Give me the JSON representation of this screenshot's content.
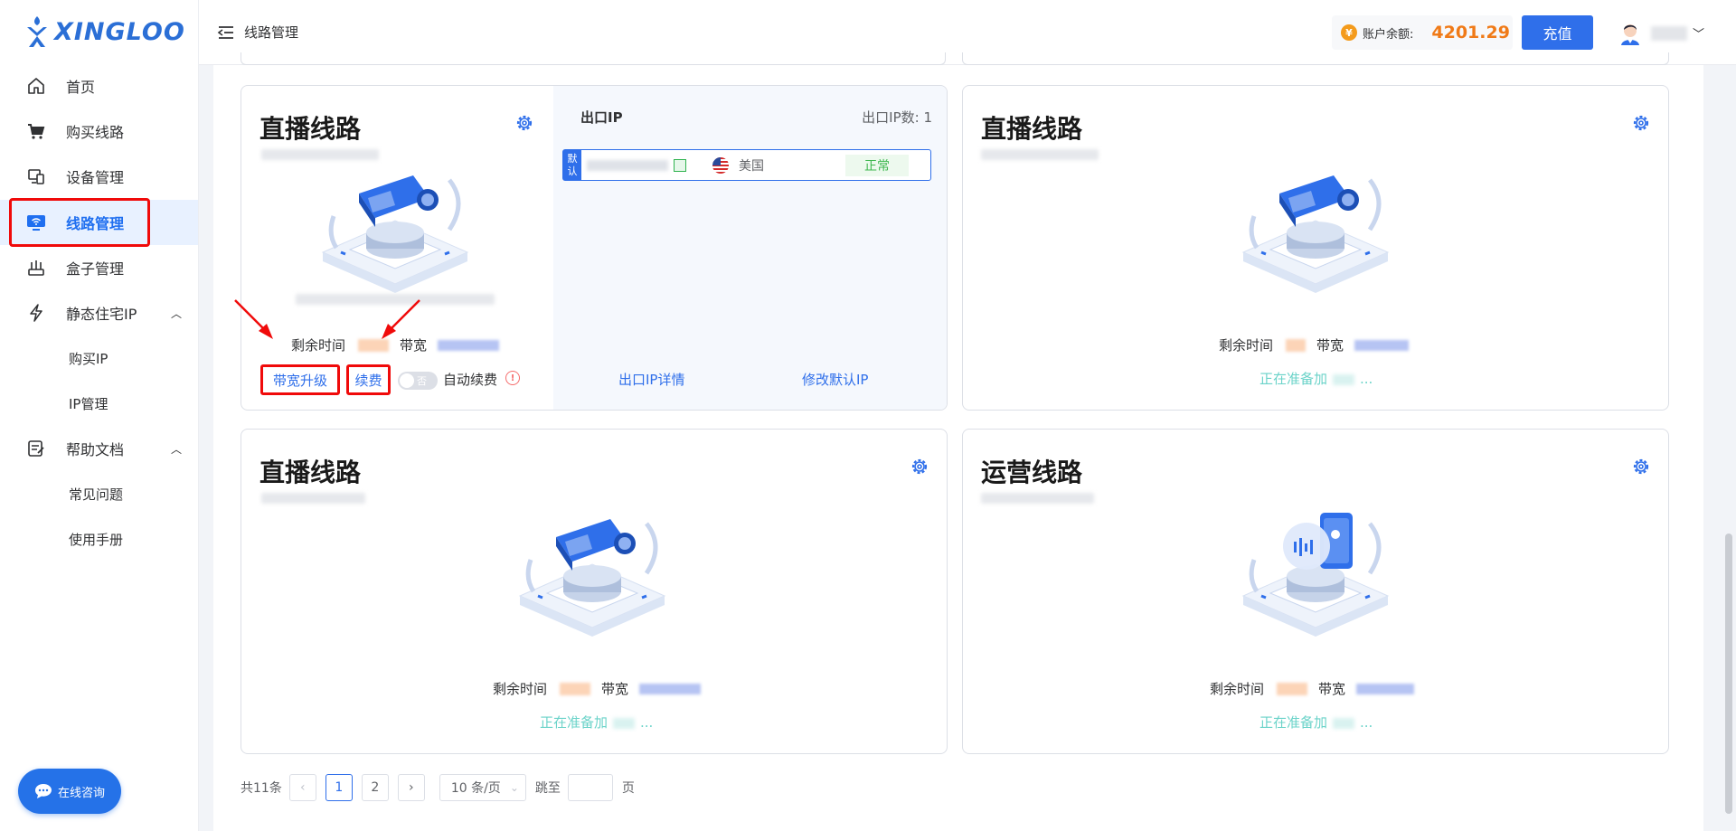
{
  "app": {
    "brand": "XINGLOO"
  },
  "sidebar": {
    "items": [
      {
        "label": "首页",
        "icon": "home-icon"
      },
      {
        "label": "购买线路",
        "icon": "cart-icon"
      },
      {
        "label": "设备管理",
        "icon": "device-icon"
      },
      {
        "label": "线路管理",
        "icon": "monitor-wifi-icon",
        "active": true
      },
      {
        "label": "盒子管理",
        "icon": "router-icon"
      },
      {
        "label": "静态住宅IP",
        "icon": "bolt-icon",
        "expanded": true
      },
      {
        "label": "帮助文档",
        "icon": "doc-icon",
        "expanded": true
      }
    ],
    "sub_static_ip": [
      "购买IP",
      "IP管理"
    ],
    "sub_help": [
      "常见问题",
      "使用手册"
    ],
    "chat_label": "在线咨询"
  },
  "header": {
    "breadcrumb": "线路管理",
    "balance_label": "账户余额:",
    "balance_value": "4201.29",
    "recharge_label": "充值"
  },
  "cards": [
    {
      "title": "直播线路",
      "type": "live",
      "remaining_label": "剩余时间",
      "bandwidth_label": "带宽",
      "egress": {
        "title": "出口IP",
        "count_label": "出口IP数: 1",
        "default_tag": [
          "默",
          "认"
        ],
        "country": "美国",
        "status": "正常",
        "details_link": "出口IP详情",
        "modify_link": "修改默认IP"
      },
      "actions": {
        "upgrade": "带宽升级",
        "renew": "续费",
        "toggle_state": "否",
        "auto_renew": "自动续费"
      }
    },
    {
      "title": "直播线路",
      "type": "live",
      "remaining_label": "剩余时间",
      "bandwidth_label": "带宽",
      "status_text": "正在准备加",
      "status_tail": "..."
    },
    {
      "title": "直播线路",
      "type": "live",
      "remaining_label": "剩余时间",
      "bandwidth_label": "带宽",
      "status_text": "正在准备加",
      "status_tail": "..."
    },
    {
      "title": "运营线路",
      "type": "ops",
      "remaining_label": "剩余时间",
      "bandwidth_label": "带宽",
      "status_text": "正在准备加",
      "status_tail": "..."
    }
  ],
  "pagination": {
    "total": "共11条",
    "pages": [
      "1",
      "2"
    ],
    "current": "1",
    "page_size": "10 条/页",
    "jump_label": "跳至",
    "page_suffix": "页",
    "prev": "‹",
    "next": "›",
    "caret": "⌄"
  },
  "colors": {
    "accent": "#2f6fea",
    "balance": "#f07a17",
    "highlight": "#f00a0a",
    "ok": "#3fb850",
    "preparing": "#6bd3c9"
  }
}
